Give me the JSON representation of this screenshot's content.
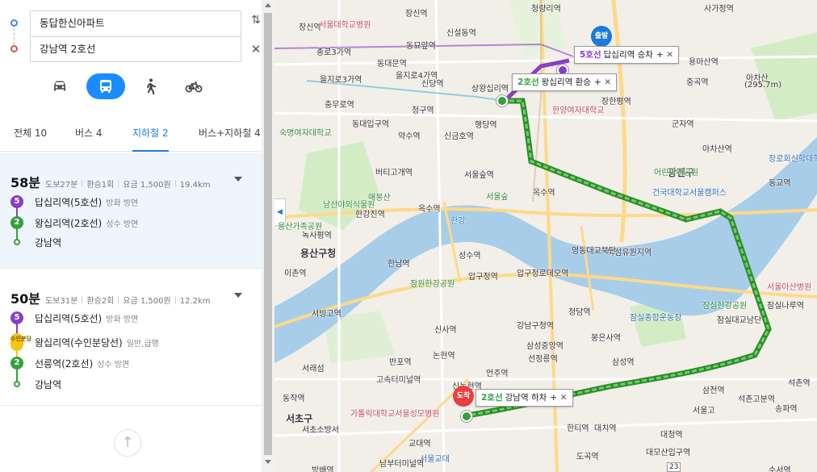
{
  "search": {
    "origin": "동답한신아파트",
    "destination": "강남역 2호선",
    "swap_symbol": "⇅",
    "clear_symbol": "✕"
  },
  "modes": [
    {
      "name": "car",
      "icon": "car-icon",
      "selected": false
    },
    {
      "name": "transit",
      "icon": "bus-icon",
      "selected": true
    },
    {
      "name": "walk",
      "icon": "walk-icon",
      "selected": false
    },
    {
      "name": "bike",
      "icon": "bike-icon",
      "selected": false
    }
  ],
  "tabs": [
    "전체 10",
    "버스 4",
    "지하철 2",
    "버스+지하철 4"
  ],
  "active_tab": "지하철 2",
  "routes": [
    {
      "time": "58분",
      "walk": "도보27분",
      "transfer": "환승1회",
      "fare": "요금 1,500원",
      "distance": "19.4km",
      "steps": [
        {
          "badge": "5",
          "name": "답십리역(5호선)",
          "dir": "방화 방면"
        },
        {
          "badge": "2",
          "name": "왕십리역(2호선)",
          "dir": "성수 방면"
        },
        {
          "badge": "",
          "name": "강남역",
          "dir": ""
        }
      ]
    },
    {
      "time": "50분",
      "walk": "도보31분",
      "transfer": "환승2회",
      "fare": "요금 1,500원",
      "distance": "12.2km",
      "steps": [
        {
          "badge": "5",
          "name": "답십리역(5호선)",
          "dir": "방화 방면"
        },
        {
          "badge": "수인분당",
          "name": "왕십리역(수인분당선)",
          "dir": "일반,급행"
        },
        {
          "badge": "2",
          "name": "선릉역(2호선)",
          "dir": "성수 방면"
        },
        {
          "badge": "",
          "name": "강남역",
          "dir": ""
        }
      ]
    }
  ],
  "up_symbol": "↑",
  "map": {
    "start_marker": "출발",
    "end_marker": "도착",
    "callouts": [
      {
        "line": "5호선",
        "text": "답십리역 승차",
        "actions": "+ ✕"
      },
      {
        "line": "2호선",
        "text": "왕십리역 환승",
        "actions": "+ ✕"
      },
      {
        "line": "2호선",
        "text": "강남역 하차",
        "actions": "+ ✕"
      }
    ],
    "districts": [
      "용산구청",
      "서초구"
    ],
    "mountain": {
      "name": "아차산",
      "height": "(295.7m)"
    },
    "labels": {
      "top": [
        "장신역",
        "청량리역",
        "사가정역",
        "창신역",
        "서울대학교병원",
        "종로3가역",
        "신설동역",
        "동묘앞역",
        "동대문역",
        "신당역",
        "을지로3가역",
        "을지로4가역",
        "충무로역",
        "동대입구역",
        "약수역",
        "청구역",
        "신금호역",
        "행당역",
        "상왕십리역",
        "한양여자대학교",
        "장한평역",
        "군자역",
        "용마산역",
        "중곡역",
        "아차산역",
        "광진구",
        "장로회신학대학교",
        "동교역"
      ],
      "mid": [
        "숙명여자대학교",
        "남산야외식물원",
        "한강진역",
        "매봉산",
        "버티고개역",
        "옥수역",
        "서울숲역",
        "서울숲",
        "한강",
        "옥수역",
        "용산가족공원",
        "녹사평역",
        "이촌역",
        "한남역",
        "성수역",
        "건국대학교서울캠퍼스",
        "어린이대공원",
        "뚝섬유원지역",
        "영동대교북단",
        "서울아산병원",
        "잠원한강공원",
        "잠실한강공원",
        "압구정로데오역",
        "압구정역",
        "잠실나루역",
        "잠실대교남단"
      ],
      "bottom": [
        "서빙고역",
        "반포역",
        "신사역",
        "강남구청역",
        "청담역",
        "봉은사역",
        "잠실종합운동장",
        "동작역",
        "서래섬",
        "고속터미널역",
        "논현역",
        "삼성중앙역",
        "선정릉역",
        "삼성역",
        "신논현역",
        "언주역",
        "석촌역",
        "가톨릭대학교서울성모병원",
        "서초소방서",
        "교대역",
        "한티역",
        "대치역",
        "대청역",
        "도곡역",
        "대모산입구역",
        "서울교대",
        "서울고",
        "방배역",
        "수서역",
        "남부터미널역",
        "삼전역",
        "석촌고분역",
        "송파역"
      ]
    },
    "road_number": "23",
    "collapse_symbol": "◀",
    "colors": {
      "line5": "#8a3ec8",
      "line2": "#33a23d",
      "river": "#a7cde8",
      "start": "#1a7ae0",
      "end": "#e84040"
    }
  }
}
